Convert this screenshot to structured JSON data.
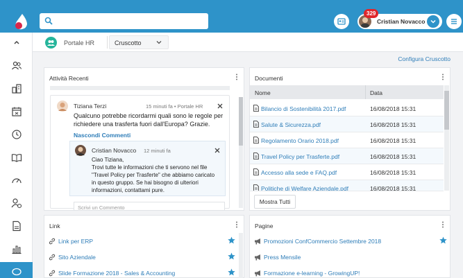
{
  "header": {
    "search_placeholder": "",
    "notifications_count": "329",
    "user_name": "Cristian Novacco"
  },
  "subheader": {
    "section_title": "Portale HR",
    "view_selector": "Cruscotto",
    "configure_link": "Configura Cruscotto"
  },
  "recent_activity": {
    "title": "Attività Recenti",
    "post": {
      "author": "Tiziana Terzi",
      "meta": "15 minuti fa • Portale HR",
      "text_line1": "Qualcuno potrebbe ricordarmi quali sono le regole per",
      "text_line2": "richiedere una trasferta fuori dall'Europa? Grazie.",
      "hide_comments": "Nascondi Commenti",
      "comment": {
        "author": "Cristian Novacco",
        "time": "12 minuti fa",
        "lines": [
          "Ciao Tiziana,",
          "Trovi tutte le informazioni che ti servono nel file",
          "\"Travel Policy per Trasferte\" che abbiamo caricato",
          "in questo gruppo. Se hai bisogno di ulteriori",
          "informazioni, contattami pure."
        ]
      },
      "comment_placeholder": "Scrivi un Commento"
    }
  },
  "documents": {
    "title": "Documenti",
    "columns": {
      "name": "Nome",
      "date": "Data"
    },
    "rows": [
      {
        "name": "Bilancio di Sostenibilità 2017.pdf",
        "date": "16/08/2018 15:31"
      },
      {
        "name": "Salute & Sicurezza.pdf",
        "date": "16/08/2018 15:31"
      },
      {
        "name": "Regolamento Orario 2018.pdf",
        "date": "16/08/2018 15:31"
      },
      {
        "name": "Travel Policy per Trasferte.pdf",
        "date": "16/08/2018 15:31"
      },
      {
        "name": "Accesso alla sede e FAQ.pdf",
        "date": "16/08/2018 15:31"
      },
      {
        "name": "Politiche di Welfare Aziendale.pdf",
        "date": "16/08/2018 15:31"
      }
    ],
    "show_all": "Mostra Tutti"
  },
  "links": {
    "title": "Link",
    "items": [
      {
        "label": "Link per ERP"
      },
      {
        "label": "Sito Aziendale"
      },
      {
        "label": "Slide Formazione 2018 - Sales & Accounting"
      }
    ]
  },
  "pages": {
    "title": "Pagine",
    "items": [
      {
        "label": "Promozioni ConfCommercio Settembre 2018"
      },
      {
        "label": "Press Mensile"
      },
      {
        "label": "Formazione e-learning - GrowingUP!"
      }
    ]
  },
  "colors": {
    "brand": "#2e93c9",
    "link": "#2e7db8",
    "hr_icon": "#25b59b",
    "badge": "#e0262b"
  }
}
